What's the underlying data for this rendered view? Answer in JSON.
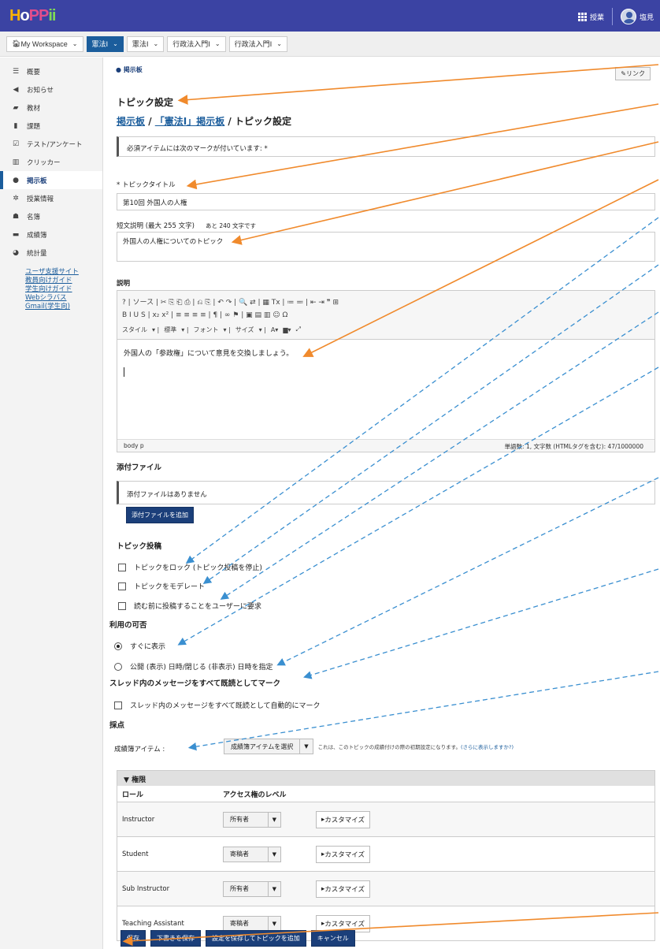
{
  "topbar": {
    "logo": [
      "H",
      "o",
      "PP",
      "ii"
    ],
    "courses_label": "授業",
    "user_name": "塩見"
  },
  "site_tabs": [
    {
      "label": "My Workspace",
      "active": false
    },
    {
      "label": "憲法Ⅰ",
      "active": true
    },
    {
      "label": "憲法Ⅰ",
      "active": false
    },
    {
      "label": "行政法入門Ⅰ",
      "active": false
    },
    {
      "label": "行政法入門Ⅰ",
      "active": false
    }
  ],
  "sidebar": {
    "items": [
      {
        "label": "概要",
        "icon": "list-icon"
      },
      {
        "label": "お知らせ",
        "icon": "megaphone-icon"
      },
      {
        "label": "教材",
        "icon": "folder-icon"
      },
      {
        "label": "課題",
        "icon": "document-icon"
      },
      {
        "label": "テスト/アンケート",
        "icon": "checkbox-icon"
      },
      {
        "label": "クリッカー",
        "icon": "bar-chart-icon"
      },
      {
        "label": "掲示板",
        "icon": "chat-icon",
        "active": true
      },
      {
        "label": "授業情報",
        "icon": "gear-icon"
      },
      {
        "label": "名簿",
        "icon": "people-icon"
      },
      {
        "label": "成績簿",
        "icon": "book-icon"
      },
      {
        "label": "統計量",
        "icon": "pie-chart-icon"
      }
    ],
    "links": [
      "ユーザ支援サイト",
      "教員向けガイド",
      "学生向けガイド",
      "Webシラバス",
      "Gmail(学生向)"
    ]
  },
  "header": {
    "tool_name": "掲示板",
    "link_button": "リンク",
    "title": "トピック設定",
    "breadcrumb": {
      "root": "掲示板",
      "sep": " / ",
      "forum": "「憲法Ⅰ」掲示板",
      "current": "トピック設定"
    }
  },
  "notice": "必須アイテムには次のマークが付いています: *",
  "form": {
    "title_label": "* トピックタイトル",
    "title_value": "第10回 外国人の人権",
    "short_desc_label": "短文説明 (最大 255 文字)",
    "short_desc_remaining": "あと 240 文字です",
    "short_desc_value": "外国人の人権についてのトピック",
    "desc_label": "説明"
  },
  "editor": {
    "toolbar_row1": "? | ソース | ✂ ⎘ ⎗ ⎙ | ⎌ ⎘ | ↶ ↷ | 🔍 ⇄ | ▦ Tx | ≔ ≕ | ⇤ ⇥ ❞ ⊞",
    "toolbar_row2": "B I U S | x₂ x² | ≡ ≡ ≡ ≡ | ¶ | ∞ ⚑ | ▣ ▤ ▥ ☺ Ω",
    "style_label": "スタイル",
    "format_label": "標準",
    "font_label": "フォント",
    "size_label": "サイズ",
    "content": "外国人の「参政権」について意見を交換しましょう。",
    "status_left": "body  p",
    "status_right": "単語数: 1, 文字数 (HTMLタグを含む): 47/1000000"
  },
  "attachments": {
    "heading": "添付ファイル",
    "empty": "添付ファイルはありません",
    "add_button": "添付ファイルを追加"
  },
  "topic_posting": {
    "heading": "トピック投稿",
    "options": [
      "トピックをロック (トピック投稿を停止)",
      "トピックをモデレート",
      "読む前に投稿することをユーザーに要求"
    ]
  },
  "availability": {
    "heading": "利用の可否",
    "options": [
      {
        "label": "すぐに表示",
        "checked": true
      },
      {
        "label": "公開 (表示) 日時/閉じる (非表示) 日時を指定",
        "checked": false
      }
    ]
  },
  "mark_read": {
    "heading": "スレッド内のメッセージをすべて既読としてマーク",
    "option": "スレッド内のメッセージをすべて既読として自動的にマーク"
  },
  "grading": {
    "heading": "採点",
    "gradebook_label": "成績簿アイテム :",
    "select_value": "成績簿アイテムを選択",
    "hint": "これは、このトピックの成績付けの際の初期設定になります。",
    "hint_link": "(さらに表示しますか?)"
  },
  "permissions": {
    "heading": "権限",
    "col_role": "ロール",
    "col_level": "アクセス権のレベル",
    "customize": "カスタマイズ",
    "rows": [
      {
        "role": "Instructor",
        "level": "所有者"
      },
      {
        "role": "Student",
        "level": "寄稿者"
      },
      {
        "role": "Sub Instructor",
        "level": "所有者"
      },
      {
        "role": "Teaching Assistant",
        "level": "寄稿者"
      }
    ]
  },
  "actions": [
    "保存",
    "下書きを保存",
    "設定を保存してトピックを追加",
    "キャンセル"
  ],
  "colors": {
    "topbar": "#3b43a3",
    "primary": "#1b3f7a",
    "arrow_solid": "#f08a2c",
    "arrow_dashed": "#3a8fd0"
  }
}
